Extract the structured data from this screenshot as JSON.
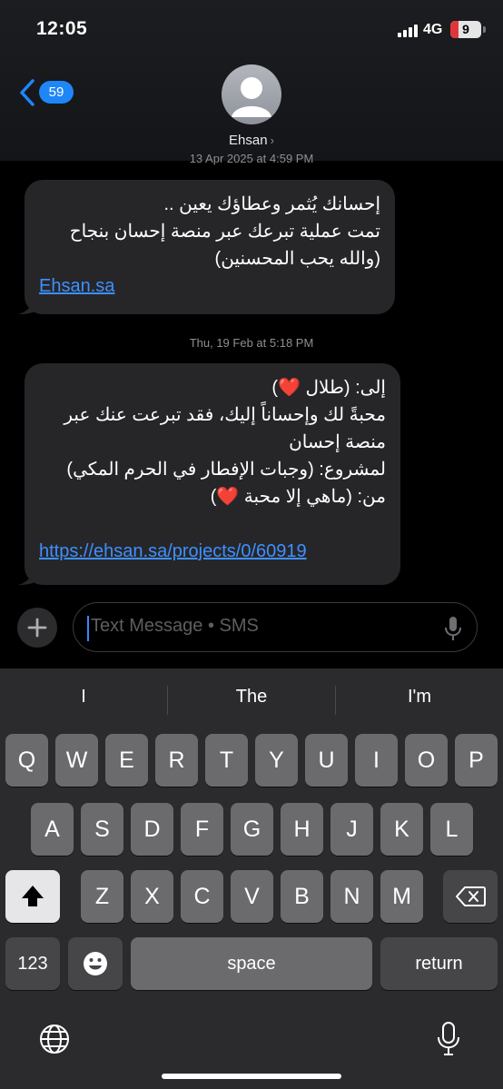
{
  "status": {
    "time": "12:05",
    "network": "4G",
    "battery": "9"
  },
  "header": {
    "back_count": "59",
    "contact_name": "Ehsan",
    "contact_chevron": "›"
  },
  "messages": [
    {
      "timestamp": "13 Apr 2025 at 4:59 PM",
      "lines": [
        "إحسانك يُثمر وعطاؤك يعين ..",
        "تمت عملية تبرعك عبر منصة إحسان بنجاح",
        "(والله يحب المحسنين)"
      ],
      "link": "Ehsan.sa"
    },
    {
      "timestamp": "Thu, 19 Feb at 5:18 PM",
      "lines": [
        "إلى: (طلال ❤️)",
        "محبةً لك وإحساناً إليك، فقد تبرعت عنك عبر",
        "منصة إحسان",
        "لمشروع: (وجبات الإفطار في الحرم المكي)",
        "من: (ماهي إلا محبة ❤️)"
      ],
      "link": "https://ehsan.sa/projects/0/60919"
    }
  ],
  "compose": {
    "placeholder": "Text Message • SMS"
  },
  "keyboard": {
    "suggestions": [
      "I",
      "The",
      "I'm"
    ],
    "row1": [
      "Q",
      "W",
      "E",
      "R",
      "T",
      "Y",
      "U",
      "I",
      "O",
      "P"
    ],
    "row2": [
      "A",
      "S",
      "D",
      "F",
      "G",
      "H",
      "J",
      "K",
      "L"
    ],
    "row3": [
      "Z",
      "X",
      "C",
      "V",
      "B",
      "N",
      "M"
    ],
    "numbers_key": "123",
    "space_key": "space",
    "return_key": "return"
  },
  "icons": [
    "back-chevron-icon",
    "person-avatar-icon",
    "plus-icon",
    "microphone-icon",
    "shift-icon",
    "delete-icon",
    "emoji-icon",
    "globe-icon",
    "dictation-icon"
  ],
  "colors": {
    "accent": "#1f86f8",
    "link": "#3e90ff",
    "bubble": "#262629",
    "battery_low": "#e0363b"
  }
}
